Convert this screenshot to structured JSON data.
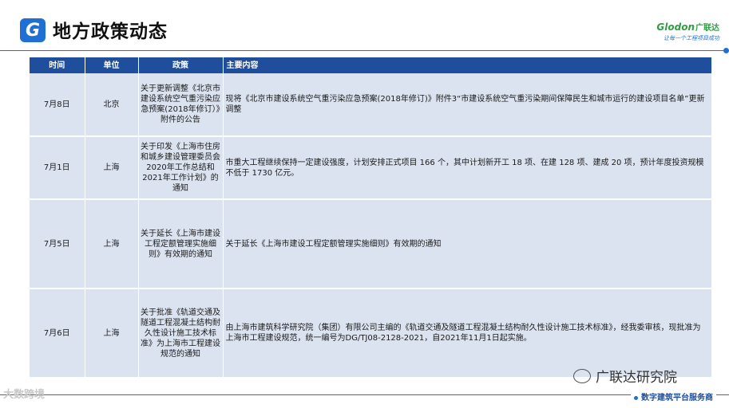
{
  "header": {
    "logo_letter": "G",
    "title": "地方政策动态",
    "brand_name": "Glodon",
    "brand_cn": "广联达",
    "brand_tagline": "让每一个工程项目成功"
  },
  "table": {
    "headers": [
      "时间",
      "单位",
      "政策",
      "主要内容"
    ],
    "rows": [
      {
        "date": "7月8日",
        "unit": "北京",
        "policy": "关于更新调整《北京市建设系统空气重污染应急预案(2018年修订）》附件的公告",
        "content": "现将《北京市建设系统空气重污染应急预案(2018年修订)》附件3“市建设系统空气重污染期间保障民生和城市运行的建设项目名单”更新调整"
      },
      {
        "date": "7月1日",
        "unit": "上海",
        "policy": "关于印发《上海市住房和城乡建设管理委员会2020年工作总结和2021年工作计划》的通知",
        "content": "市重大工程继续保持一定建设强度，计划安排正式项目 166 个，其中计划新开工 18 项、在建 128 项、建成 20 项，预计年度投资规模不低于 1730 亿元。"
      },
      {
        "date": "7月5日",
        "unit": "上海",
        "policy": "关于延长《上海市建设工程定额管理实施细则》有效期的通知",
        "content": "关于延长《上海市建设工程定额管理实施细则》有效期的通知"
      },
      {
        "date": "7月6日",
        "unit": "上海",
        "policy": "关于批准《轨道交通及隧道工程混凝土结构耐久性设计施工技术标准》为上海市工程建设规范的通知",
        "content": "由上海市建筑科学研究院（集团）有限公司主编的《轨道交通及隧道工程混凝土结构耐久性设计施工技术标准》，经我委审核，现批准为上海市工程建设规范，统一编号为DG/TJ08-2128-2021，自2021年11月1日起实施。"
      }
    ]
  },
  "footer": {
    "watermark": "广联达研究院",
    "tagline": "数字建筑平台服务商",
    "corner_watermark": "大数跨境"
  }
}
